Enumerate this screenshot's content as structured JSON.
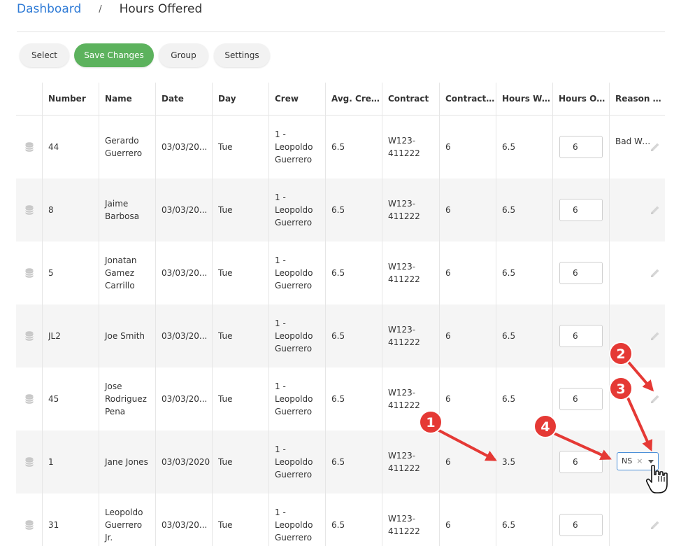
{
  "breadcrumb": {
    "home": "Dashboard",
    "separator": "/",
    "current": "Hours Offered"
  },
  "toolbar": {
    "select": "Select",
    "save": "Save Changes",
    "group": "Group",
    "settings": "Settings"
  },
  "colors": {
    "accent_green": "#5cb25d",
    "link_blue": "#2f7bd6",
    "annotation_red": "#e53935",
    "row_alt": "#f5f5f5"
  },
  "table": {
    "headers": [
      "Number",
      "Name",
      "Date",
      "Day",
      "Crew",
      "Avg. Crew...",
      "Contract",
      "Contract ...",
      "Hours Wo...",
      "Hours Off...",
      "Reason C..."
    ],
    "rows": [
      {
        "number": "44",
        "name": "Gerardo Guerrero",
        "date": "03/03/20...",
        "day": "Tue",
        "crew": "1 - Leopoldo Guerrero",
        "avg": "6.5",
        "contract": "W123-411222",
        "contract2": "6",
        "hours_worked": "6.5",
        "hours_offered": "6",
        "reason": "Bad Weathe"
      },
      {
        "number": "8",
        "name": "Jaime Barbosa",
        "date": "03/03/20...",
        "day": "Tue",
        "crew": "1 - Leopoldo Guerrero",
        "avg": "6.5",
        "contract": "W123-411222",
        "contract2": "6",
        "hours_worked": "6.5",
        "hours_offered": "6",
        "reason": ""
      },
      {
        "number": "5",
        "name": "Jonatan Gamez Carrillo",
        "date": "03/03/20...",
        "day": "Tue",
        "crew": "1 - Leopoldo Guerrero",
        "avg": "6.5",
        "contract": "W123-411222",
        "contract2": "6",
        "hours_worked": "6.5",
        "hours_offered": "6",
        "reason": ""
      },
      {
        "number": "JL2",
        "name": "Joe Smith",
        "date": "03/03/20...",
        "day": "Tue",
        "crew": "1 - Leopoldo Guerrero",
        "avg": "6.5",
        "contract": "W123-411222",
        "contract2": "6",
        "hours_worked": "6.5",
        "hours_offered": "6",
        "reason": ""
      },
      {
        "number": "45",
        "name": "Jose Rodriguez Pena",
        "date": "03/03/20...",
        "day": "Tue",
        "crew": "1 - Leopoldo Guerrero",
        "avg": "6.5",
        "contract": "W123-411222",
        "contract2": "6",
        "hours_worked": "6.5",
        "hours_offered": "6",
        "reason": ""
      },
      {
        "number": "1",
        "name": "Jane Jones",
        "date": "03/03/2020",
        "day": "Tue",
        "crew": "1 - Leopoldo Guerrero",
        "avg": "6.5",
        "contract": "W123-411222",
        "contract2": "6",
        "hours_worked": "3.5",
        "hours_offered": "6",
        "reason": "NS",
        "reason_editing": true
      },
      {
        "number": "31",
        "name": "Leopoldo Guerrero Jr.",
        "date": "03/03/20...",
        "day": "Tue",
        "crew": "1 - Leopoldo Guerrero",
        "avg": "6.5",
        "contract": "W123-411222",
        "contract2": "6",
        "hours_worked": "6.5",
        "hours_offered": "6",
        "reason": ""
      }
    ]
  },
  "reason_select": {
    "value": "NS",
    "clear_symbol": "×"
  },
  "annotations": [
    "1",
    "2",
    "3",
    "4"
  ],
  "icons": {
    "row_handle": "database-icon",
    "edit": "pencil-icon",
    "cursor": "hand-pointer-icon"
  }
}
